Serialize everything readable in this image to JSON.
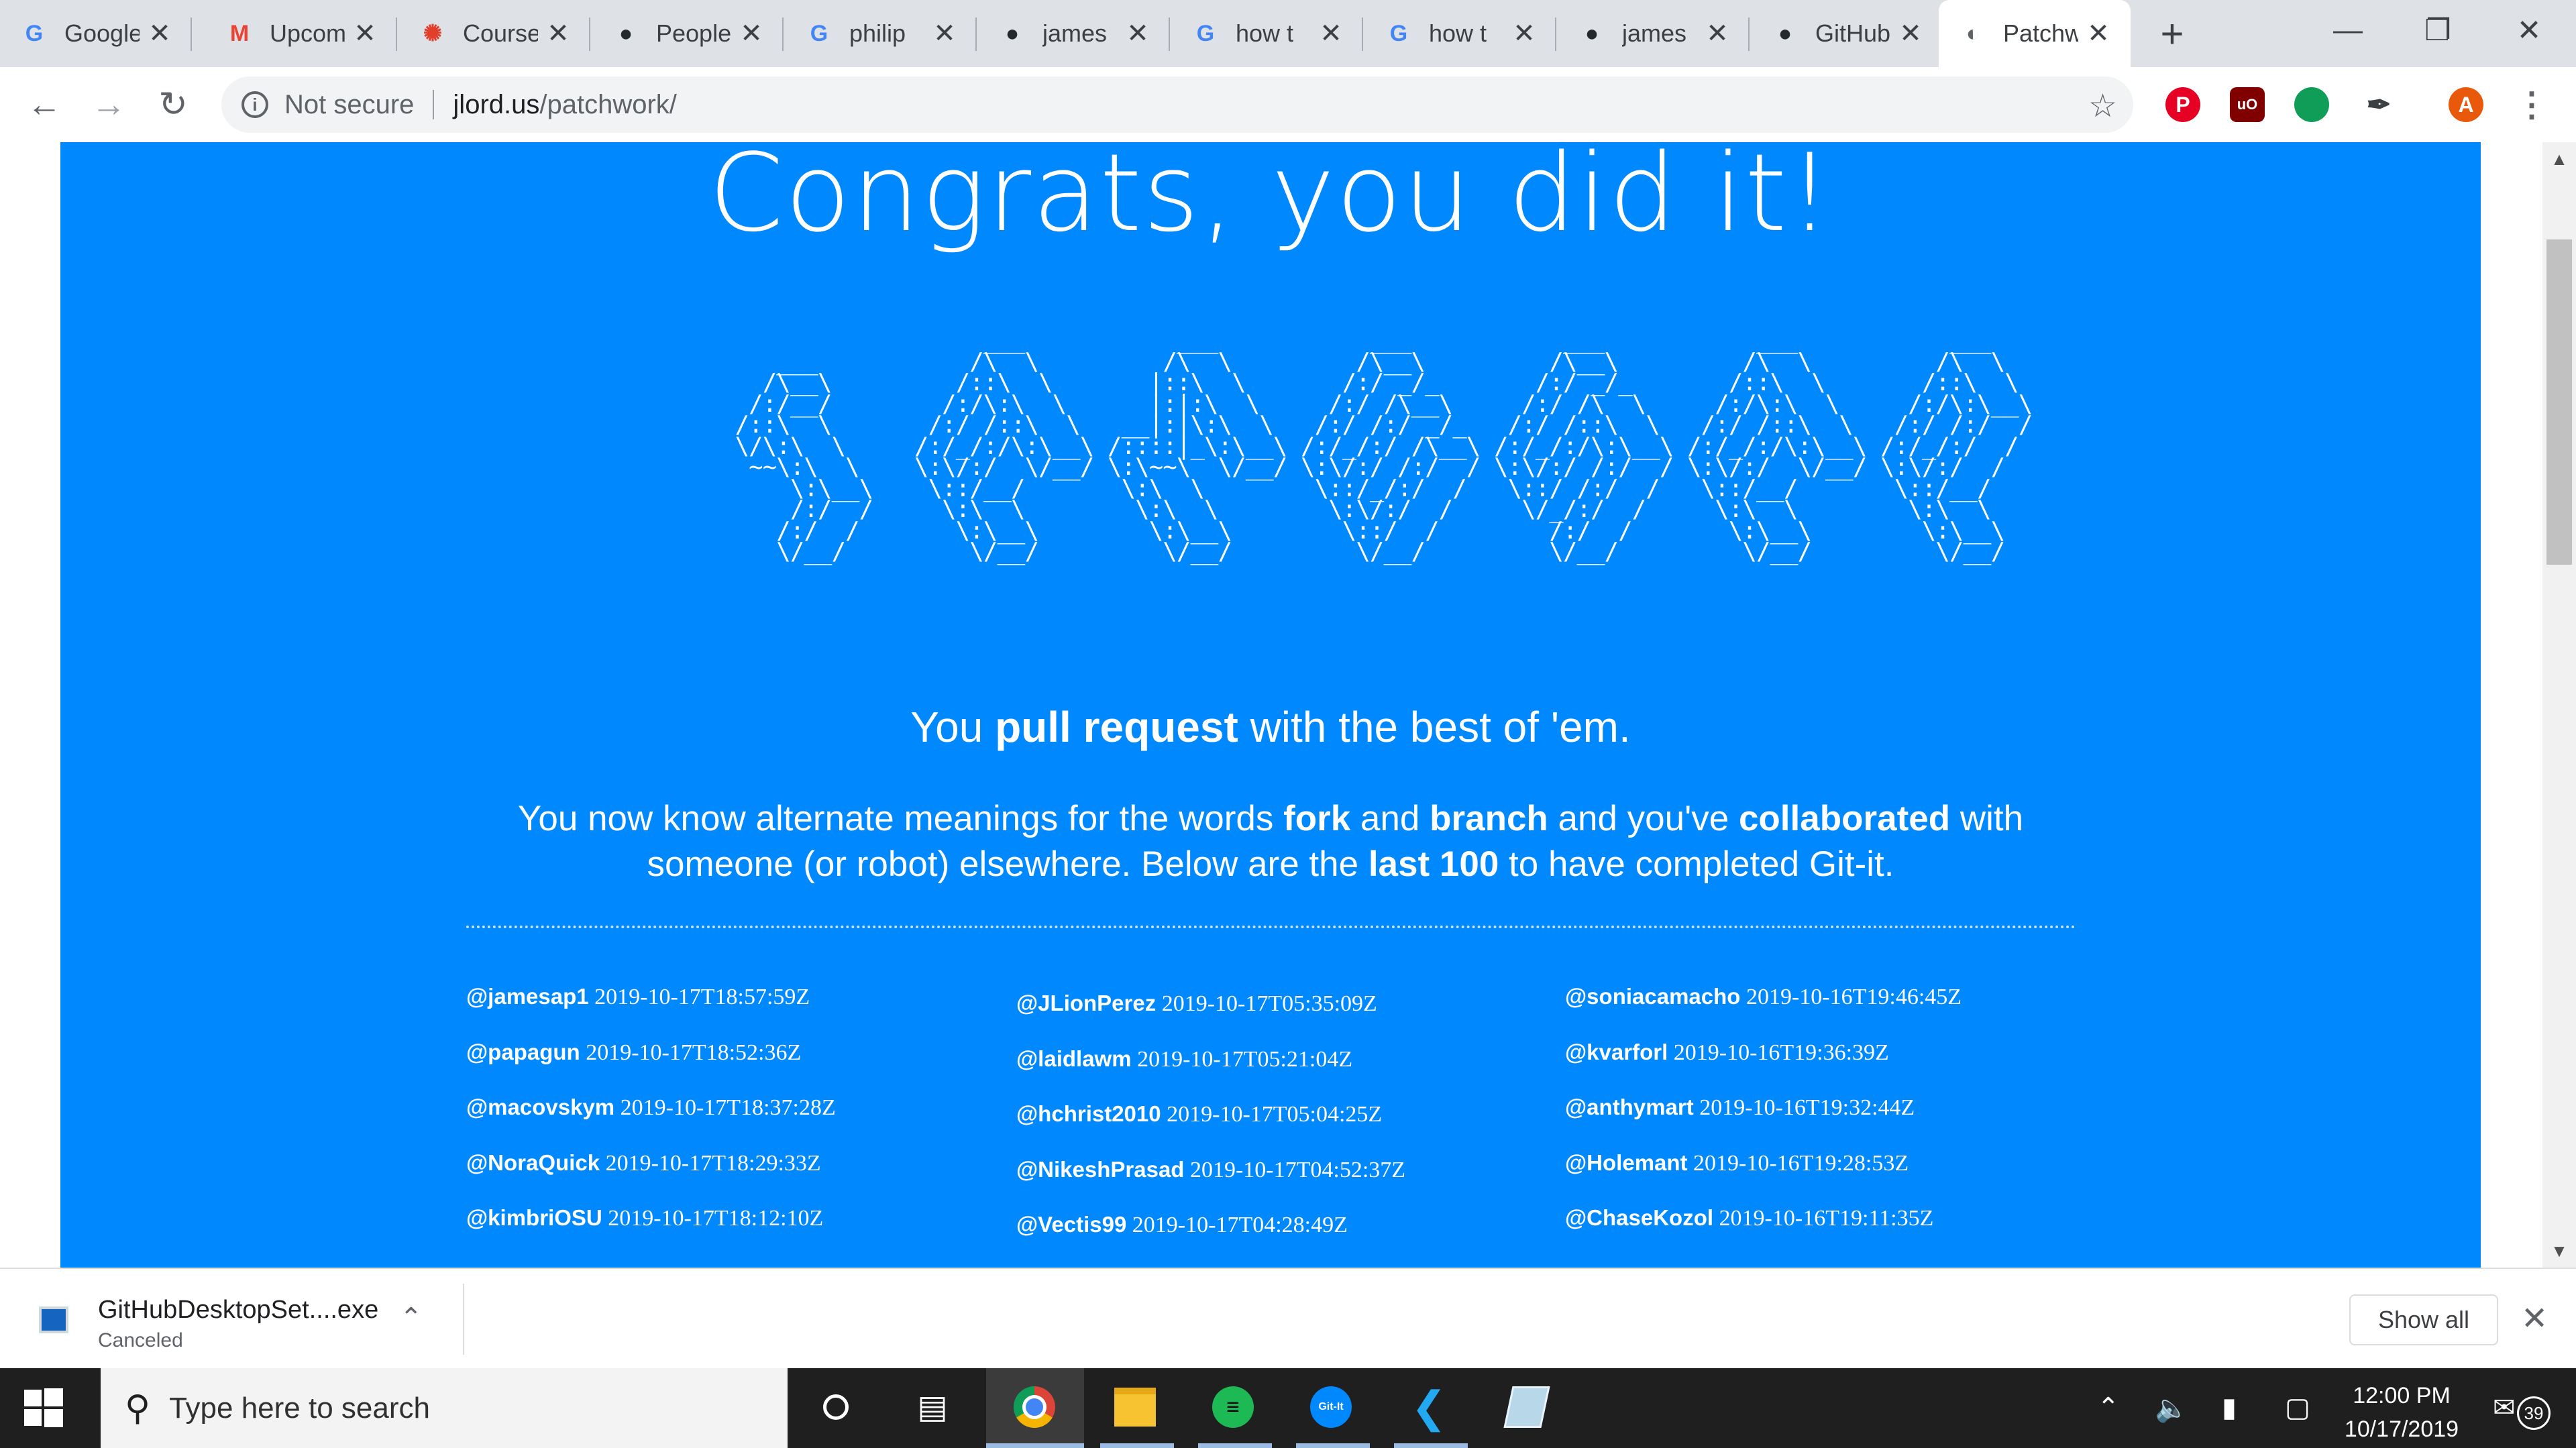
{
  "browser": {
    "tabs": [
      {
        "title": "Google",
        "icon": "google-icon",
        "color": "#4285f4"
      },
      {
        "title": "Upcoming",
        "icon": "gmail-icon",
        "color": "#ea4335"
      },
      {
        "title": "Courses",
        "icon": "canvas-icon",
        "color": "#e13f2b"
      },
      {
        "title": "People",
        "icon": "github-icon",
        "color": "#24292e"
      },
      {
        "title": "philip",
        "icon": "google-icon",
        "color": "#4285f4"
      },
      {
        "title": "james",
        "icon": "github-icon",
        "color": "#24292e"
      },
      {
        "title": "how t",
        "icon": "google-icon",
        "color": "#4285f4"
      },
      {
        "title": "how t",
        "icon": "google-icon",
        "color": "#4285f4"
      },
      {
        "title": "james",
        "icon": "github-icon",
        "color": "#24292e"
      },
      {
        "title": "GitHub",
        "icon": "github-icon",
        "color": "#24292e"
      },
      {
        "title": "Patchwork",
        "icon": "globe-icon",
        "color": "#5f6368",
        "active": true
      }
    ],
    "address": {
      "security_label": "Not secure",
      "host": "jlord.us",
      "path": "/patchwork/"
    },
    "profile_initial": "A"
  },
  "page": {
    "headline": "Congrats, you did it!",
    "tagline_pre": "You ",
    "tagline_bold": "pull request",
    "tagline_post": " with the best of 'em.",
    "summary": {
      "p1": "You now know alternate meanings for the words ",
      "b1": "fork",
      "p2": " and ",
      "b2": "branch",
      "p3": " and you've ",
      "b3": "collaborated",
      "p4": " with someone (or robot) elsewhere. Below are the ",
      "b4": "last 100",
      "p5": " to have completed Git-it."
    },
    "completions": [
      [
        {
          "user": "@jamesap1",
          "time": "2019-10-17T18:57:59Z"
        },
        {
          "user": "@papagun",
          "time": "2019-10-17T18:52:36Z"
        },
        {
          "user": "@macovskym",
          "time": "2019-10-17T18:37:28Z"
        },
        {
          "user": "@NoraQuick",
          "time": "2019-10-17T18:29:33Z"
        },
        {
          "user": "@kimbriOSU",
          "time": "2019-10-17T18:12:10Z"
        }
      ],
      [
        {
          "user": "@JLionPerez",
          "time": "2019-10-17T05:35:09Z"
        },
        {
          "user": "@laidlawm",
          "time": "2019-10-17T05:21:04Z"
        },
        {
          "user": "@hchrist2010",
          "time": "2019-10-17T05:04:25Z"
        },
        {
          "user": "@NikeshPrasad",
          "time": "2019-10-17T04:52:37Z"
        },
        {
          "user": "@Vectis99",
          "time": "2019-10-17T04:28:49Z"
        }
      ],
      [
        {
          "user": "@soniacamacho",
          "time": "2019-10-16T19:46:45Z"
        },
        {
          "user": "@kvarforl",
          "time": "2019-10-16T19:36:39Z"
        },
        {
          "user": "@anthymart",
          "time": "2019-10-16T19:32:44Z"
        },
        {
          "user": "@Holemant",
          "time": "2019-10-16T19:28:53Z"
        },
        {
          "user": "@ChaseKozol",
          "time": "2019-10-16T19:11:35Z"
        }
      ]
    ]
  },
  "download": {
    "filename": "GitHubDesktopSet....exe",
    "status": "Canceled",
    "show_all": "Show all"
  },
  "taskbar": {
    "search_placeholder": "Type here to search",
    "time": "12:00 PM",
    "date": "10/17/2019",
    "notification_count": "39"
  },
  "colors": {
    "page_blue": "#0088ff",
    "tab_strip": "#dee1e6",
    "taskbar": "#1f1f1f"
  }
}
